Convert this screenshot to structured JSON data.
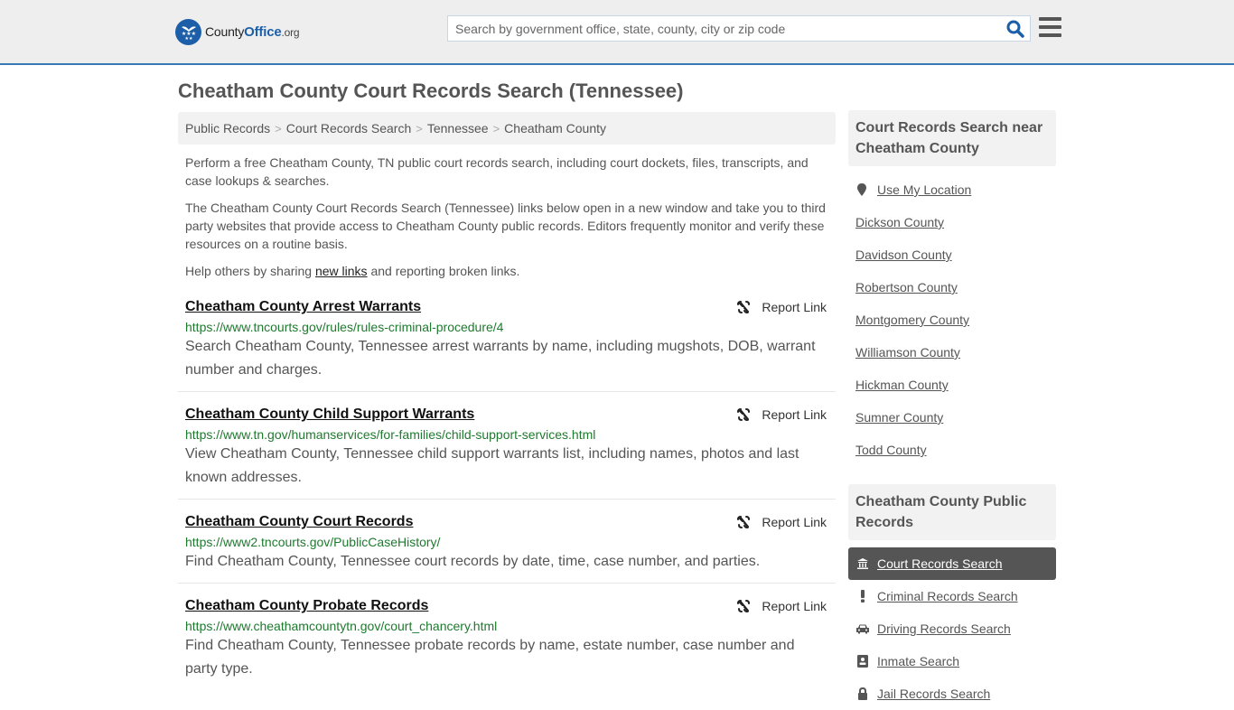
{
  "header": {
    "logo": {
      "brand_a": "County",
      "brand_b": "Office",
      "brand_c": ".org"
    },
    "search": {
      "placeholder": "Search by government office, state, county, city or zip code",
      "value": ""
    }
  },
  "page": {
    "title": "Cheatham County Court Records Search (Tennessee)"
  },
  "breadcrumb": [
    {
      "label": "Public Records"
    },
    {
      "label": "Court Records Search"
    },
    {
      "label": "Tennessee"
    },
    {
      "label": "Cheatham County"
    }
  ],
  "breadcrumb_separator": ">",
  "intro": {
    "p1": "Perform a free Cheatham County, TN public court records search, including court dockets, files, transcripts, and case lookups & searches.",
    "p2": "The Cheatham County Court Records Search (Tennessee) links below open in a new window and take you to third party websites that provide access to Cheatham County public records. Editors frequently monitor and verify these resources on a routine basis.",
    "p3_before": "Help others by sharing ",
    "p3_link": "new links",
    "p3_after": " and reporting broken links."
  },
  "report_label": "Report Link",
  "results": [
    {
      "title": "Cheatham County Arrest Warrants",
      "url": "https://www.tncourts.gov/rules/rules-criminal-procedure/4",
      "desc": "Search Cheatham County, Tennessee arrest warrants by name, including mugshots, DOB, warrant number and charges."
    },
    {
      "title": "Cheatham County Child Support Warrants",
      "url": "https://www.tn.gov/humanservices/for-families/child-support-services.html",
      "desc": "View Cheatham County, Tennessee child support warrants list, including names, photos and last known addresses."
    },
    {
      "title": "Cheatham County Court Records",
      "url": "https://www2.tncourts.gov/PublicCaseHistory/",
      "desc": "Find Cheatham County, Tennessee court records by date, time, case number, and parties."
    },
    {
      "title": "Cheatham County Probate Records",
      "url": "https://www.cheathamcountytn.gov/court_chancery.html",
      "desc": "Find Cheatham County, Tennessee probate records by name, estate number, case number and party type."
    }
  ],
  "sidebar": {
    "nearby_heading": "Court Records Search near Cheatham County",
    "use_location": "Use My Location",
    "nearby": [
      {
        "label": "Dickson County"
      },
      {
        "label": "Davidson County"
      },
      {
        "label": "Robertson County"
      },
      {
        "label": "Montgomery County"
      },
      {
        "label": "Williamson County"
      },
      {
        "label": "Hickman County"
      },
      {
        "label": "Sumner County"
      },
      {
        "label": "Todd County"
      }
    ],
    "records_heading": "Cheatham County Public Records",
    "records": [
      {
        "label": "Court Records Search",
        "icon": "courthouse-icon",
        "active": true
      },
      {
        "label": "Criminal Records Search",
        "icon": "exclamation-icon",
        "active": false
      },
      {
        "label": "Driving Records Search",
        "icon": "car-icon",
        "active": false
      },
      {
        "label": "Inmate Search",
        "icon": "id-badge-icon",
        "active": false
      },
      {
        "label": "Jail Records Search",
        "icon": "lock-icon",
        "active": false
      }
    ]
  },
  "colors": {
    "brand_blue": "#1c5fa8",
    "header_border": "#3a7ab4",
    "url_green": "#1e7a2e",
    "active_bg": "#555555"
  }
}
